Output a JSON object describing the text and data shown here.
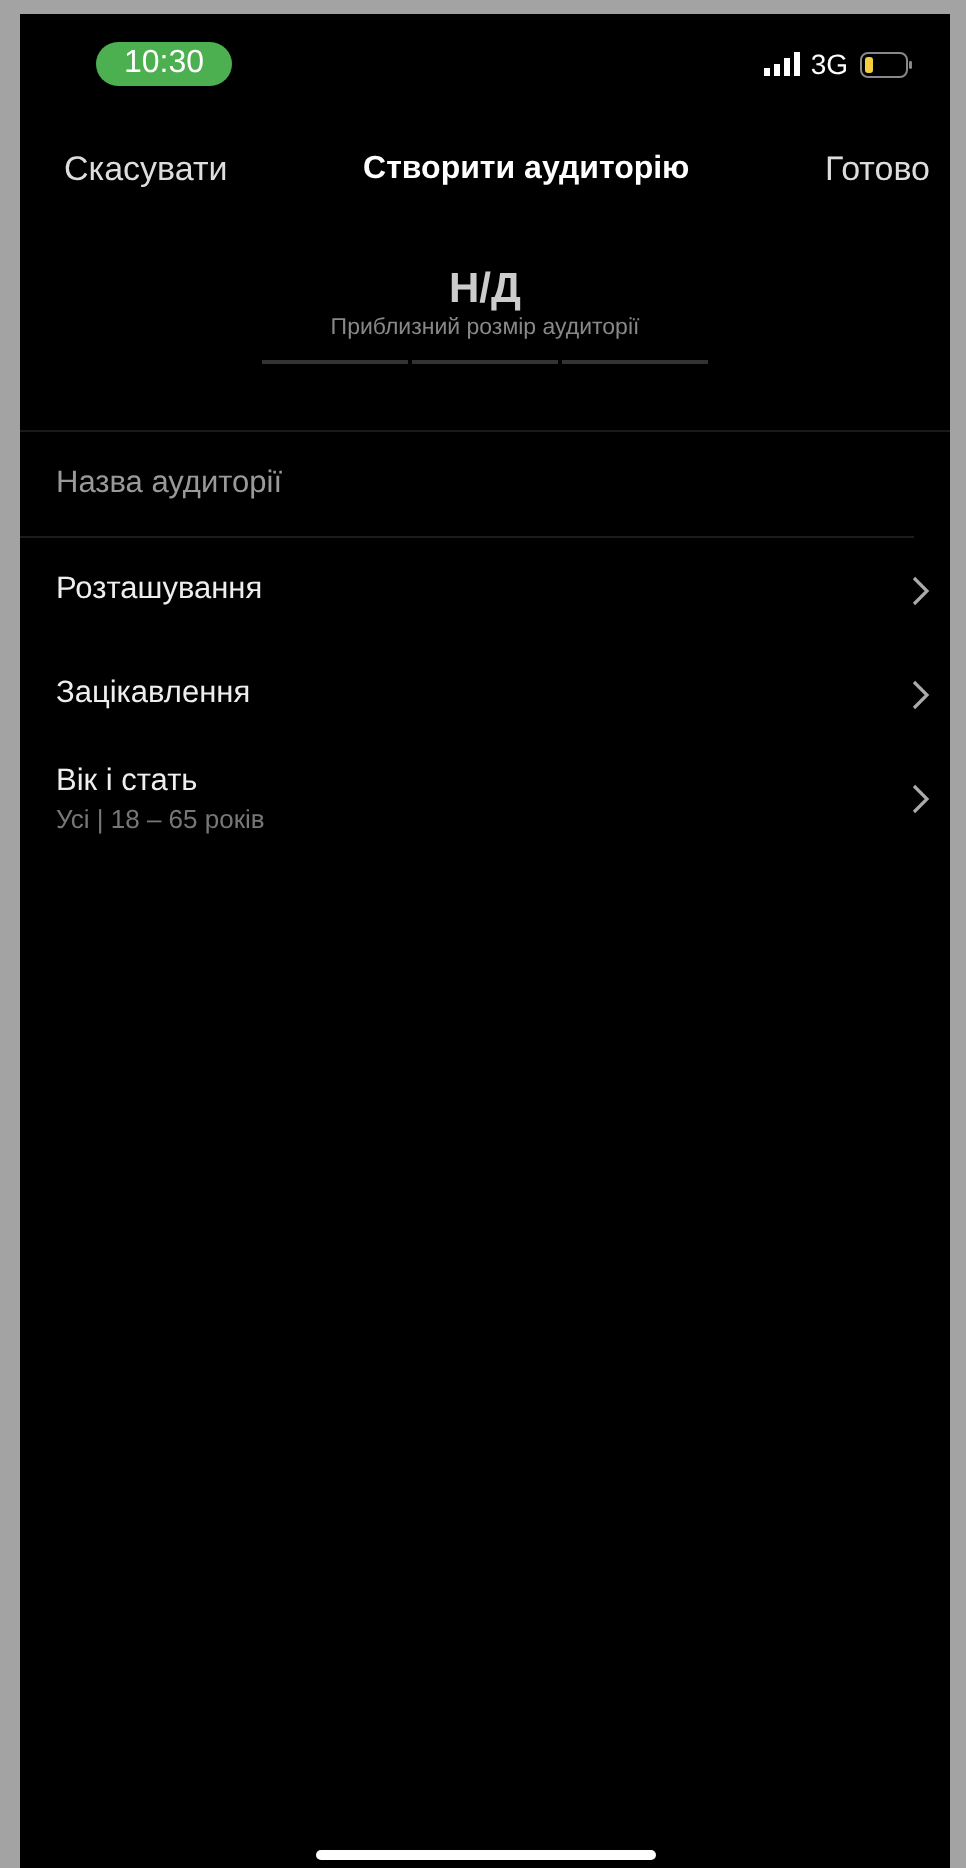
{
  "status_bar": {
    "time": "10:30",
    "network": "3G"
  },
  "nav": {
    "cancel": "Скасувати",
    "title": "Створити аудиторію",
    "done": "Готово"
  },
  "audience_size": {
    "value": "Н/Д",
    "caption": "Приблизний розмір аудиторії"
  },
  "name_field": {
    "placeholder": "Назва аудиторії"
  },
  "rows": [
    {
      "label": "Розташування"
    },
    {
      "label": "Зацікавлення"
    },
    {
      "label": "Вік і стать",
      "detail": "Усі | 18 – 65 років"
    }
  ]
}
